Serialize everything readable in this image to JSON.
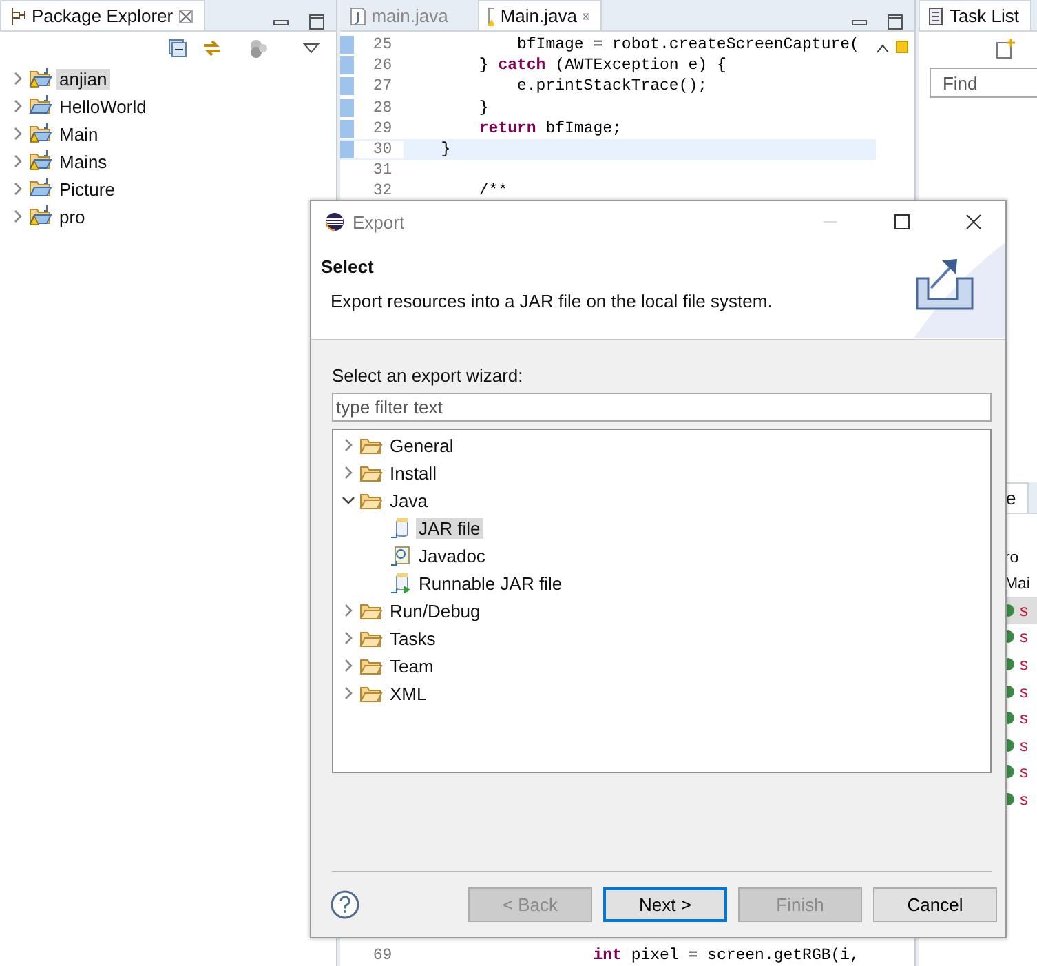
{
  "package_explorer": {
    "title": "Package Explorer",
    "projects": [
      {
        "name": "anjian",
        "warning": true,
        "selected": true
      },
      {
        "name": "HelloWorld",
        "warning": false,
        "selected": false
      },
      {
        "name": "Main",
        "warning": true,
        "selected": false
      },
      {
        "name": "Mains",
        "warning": true,
        "selected": false
      },
      {
        "name": "Picture",
        "warning": false,
        "selected": false
      },
      {
        "name": "pro",
        "warning": true,
        "selected": false
      }
    ]
  },
  "editor": {
    "tabs": [
      {
        "label": "main.java",
        "selected": false,
        "warning": false
      },
      {
        "label": "Main.java",
        "selected": true,
        "warning": true
      }
    ],
    "lines": [
      {
        "number": "25",
        "code": "            bfImage = robot.createScreenCapture(",
        "current": false
      },
      {
        "number": "26",
        "code": "        } **catch** (AWTException e) {",
        "current": false
      },
      {
        "number": "27",
        "code": "            e.printStackTrace();",
        "current": false
      },
      {
        "number": "28",
        "code": "        }",
        "current": false
      },
      {
        "number": "29",
        "code": "        **return** bfImage;",
        "current": false
      },
      {
        "number": "30",
        "code": "    }",
        "current": true
      },
      {
        "number": "31",
        "current": false
      },
      {
        "number": "32",
        "code": "        /**",
        "current": false
      }
    ],
    "bottom_line": {
      "number": "69",
      "code": "                    **int** pixel = screen.getRGB(i,"
    }
  },
  "task_list": {
    "title": "Task List",
    "search": {
      "placeholder": "Find"
    }
  },
  "side_view": {
    "tab": "e",
    "lines": [
      "ro",
      "Mai"
    ],
    "items": [
      "s",
      "s",
      "s",
      "s",
      "s",
      "s",
      "s",
      "s"
    ]
  },
  "dialog": {
    "title": "Export",
    "heading": "Select",
    "description": "Export resources into a JAR file on the local file system.",
    "filter_label": "Select an export wizard:",
    "filter": {
      "placeholder": "type filter text"
    },
    "tree": [
      {
        "label": "General",
        "kind": "folder",
        "expanded": false,
        "selected": false
      },
      {
        "label": "Install",
        "kind": "folder",
        "expanded": false,
        "selected": false
      },
      {
        "label": "Java",
        "kind": "folder",
        "expanded": true,
        "selected": false,
        "children": [
          {
            "label": "JAR file",
            "kind": "jar",
            "selected": true
          },
          {
            "label": "Javadoc",
            "kind": "javadoc",
            "selected": false
          },
          {
            "label": "Runnable JAR file",
            "kind": "runnable",
            "selected": false
          }
        ]
      },
      {
        "label": "Run/Debug",
        "kind": "folder",
        "expanded": false,
        "selected": false
      },
      {
        "label": "Tasks",
        "kind": "folder",
        "expanded": false,
        "selected": false
      },
      {
        "label": "Team",
        "kind": "folder",
        "expanded": false,
        "selected": false
      },
      {
        "label": "XML",
        "kind": "folder",
        "expanded": false,
        "selected": false
      }
    ],
    "buttons": [
      {
        "label": "< Back",
        "disabled": true,
        "default": false
      },
      {
        "label": "Next >",
        "disabled": false,
        "default": true
      },
      {
        "label": "Finish",
        "disabled": true,
        "default": false
      },
      {
        "label": "Cancel",
        "disabled": false,
        "default": false
      }
    ]
  }
}
